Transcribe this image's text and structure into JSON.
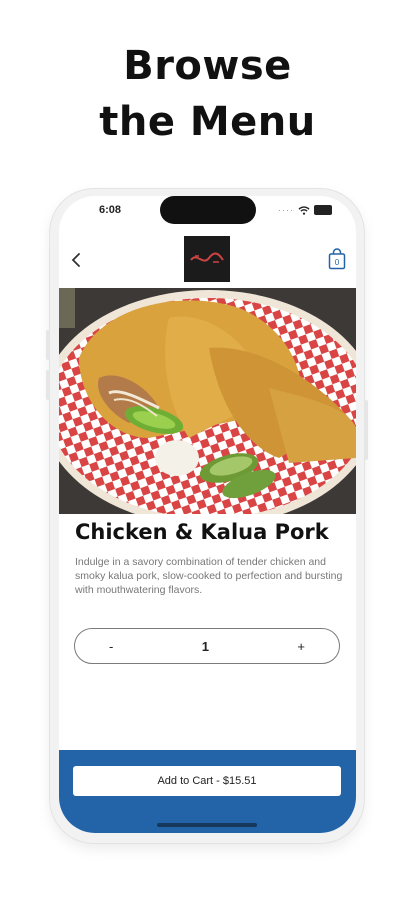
{
  "headline": {
    "line1": "Browse",
    "line2": "the Menu"
  },
  "status_bar": {
    "time": "6:08"
  },
  "nav": {
    "back_icon": "chevron-left-icon",
    "cart_badge": "0",
    "logo_icon": "restaurant-logo"
  },
  "product": {
    "title": "Chicken & Kalua Pork",
    "description": "Indulge in a savory combination of tender chicken and smoky kalua pork, slow-cooked to perfection and bursting with mouthwatering flavors.",
    "image_icon": "food-photo"
  },
  "stepper": {
    "minus": "-",
    "quantity": "1",
    "plus": "+"
  },
  "cart": {
    "button_label": "Add to Cart - $15.51"
  },
  "colors": {
    "accent": "#2364a8",
    "checker_red": "#d94545"
  }
}
